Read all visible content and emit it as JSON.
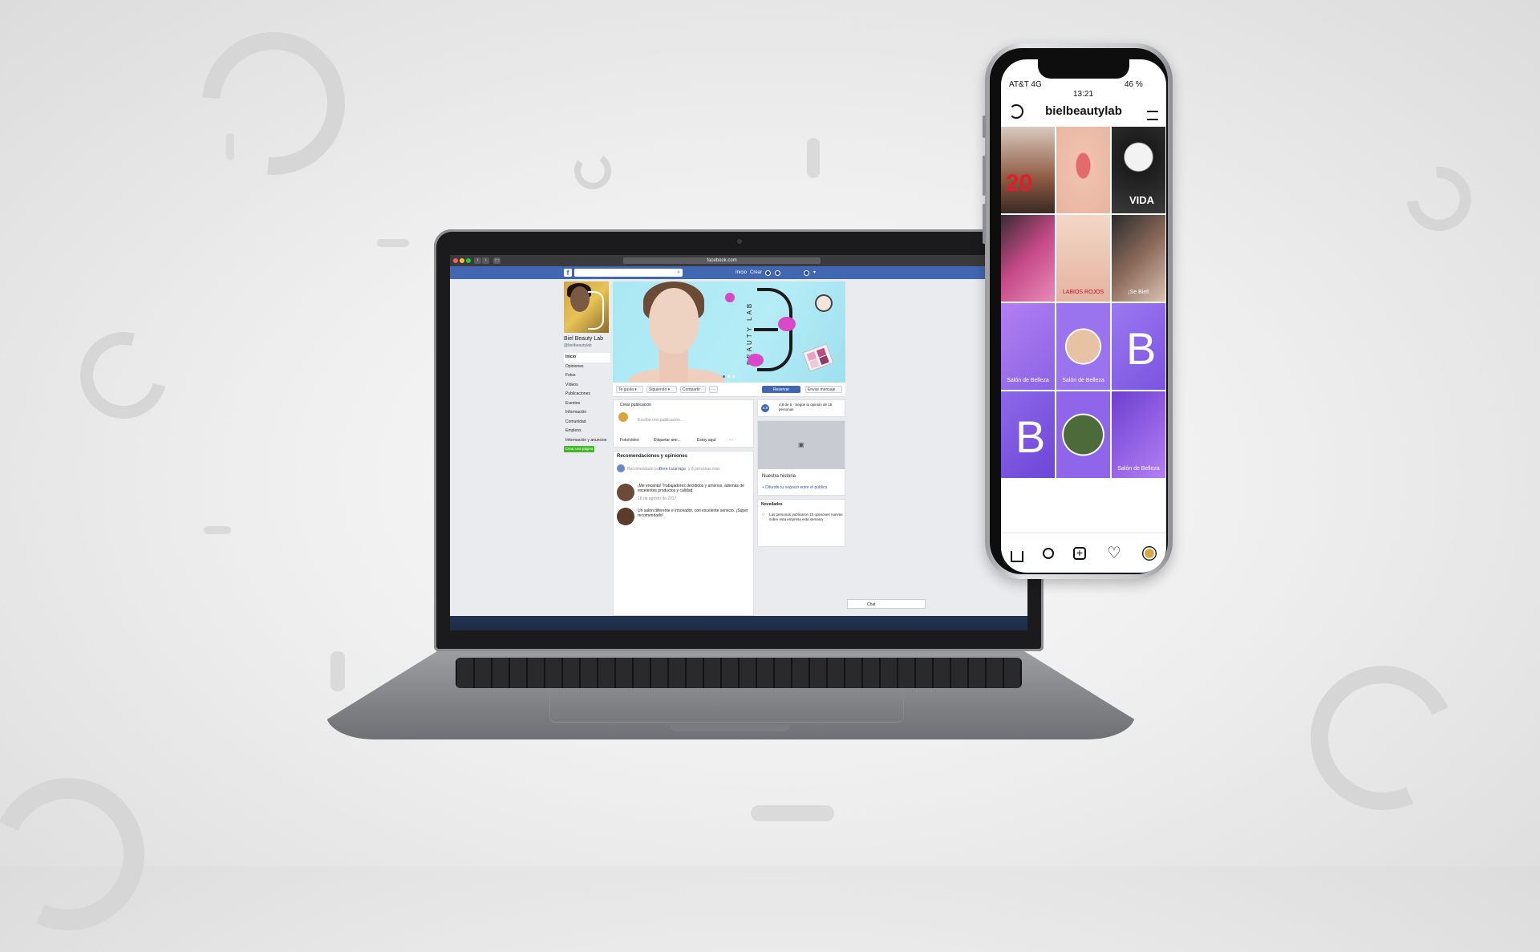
{
  "laptop": {
    "browser": {
      "url": "facebook.com"
    },
    "fb": {
      "search_icon": "search-icon",
      "nav": [
        "Inicio",
        "Crear"
      ],
      "page": {
        "name": "Biel Beauty Lab",
        "handle": "@bielbeautylab",
        "sidebar": [
          "Inicio",
          "Opiniones",
          "Fotos",
          "Vídeos",
          "Publicaciones",
          "Eventos",
          "Información",
          "Comunidad",
          "Empleos",
          "Información y anuncios"
        ],
        "promote_button": "Crear una página"
      },
      "actions": {
        "like": "Te gusta",
        "following": "Siguiendo",
        "share": "Compartir",
        "more": "···",
        "book": "Reservar",
        "message": "Enviar mensaje"
      },
      "cover": {
        "brand": "BEAUTY LAB"
      },
      "composer": {
        "header": "Crear publicación",
        "placeholder": "Escribe una publicación...",
        "photo": "Foto/vídeo",
        "tag": "Etiquetar ami...",
        "checkin": "Estoy aquí",
        "more": "···"
      },
      "reviews": {
        "title": "Recomendaciones y opiniones",
        "recommended_prefix": "Recomendado por",
        "recommended_names": "Bere Lizarraga",
        "recommended_suffix": "y 8 personas más",
        "items": [
          {
            "text": "¡Me encanta! Trabajadores decididos y amenos, además de excelentes productos y calidad.",
            "date": "18 de agosto de 2017"
          },
          {
            "text": "Un salón diferente e innovador, con excelente servicio. ¡Súper recomendado!",
            "date": ""
          }
        ]
      },
      "rating": {
        "score": "4.8",
        "text": "4,8 de 5 · Según la opinión de 15 personas"
      },
      "story": {
        "title": "Nuestra historia",
        "link": "+ Difunde tu negocio entre el público"
      },
      "news": {
        "title": "Novedades",
        "text": "Las personas publicaron 10 opiniones nuevas sobre esta empresa esta semana"
      },
      "chat": "Chat"
    }
  },
  "phone": {
    "status": {
      "carrier": "AT&T 4G",
      "time": "13:21",
      "battery": "46 %"
    },
    "instagram": {
      "username": "bielbeautylab",
      "tiles": [
        {
          "caption": "",
          "big": "20"
        },
        {
          "caption": "",
          "big": ""
        },
        {
          "caption": "",
          "big": "VIDA"
        },
        {
          "caption": "",
          "big": ""
        },
        {
          "caption": "LABIOS ROJOS",
          "big": ""
        },
        {
          "caption": "¡Se Biel!",
          "big": ""
        },
        {
          "caption": "Salón de Belleza",
          "big": ""
        },
        {
          "caption": "Salón de Belleza",
          "big": ""
        },
        {
          "caption": "",
          "big": "B"
        },
        {
          "caption": "",
          "big": "B"
        },
        {
          "caption": "",
          "big": ""
        },
        {
          "caption": "Salón de Belleza",
          "big": ""
        }
      ],
      "nav_icons": [
        "home-icon",
        "search-icon",
        "add-icon",
        "heart-icon",
        "profile-icon"
      ]
    }
  },
  "colors": {
    "fb_blue": "#4267b2",
    "ig_purple": "#8b63e6",
    "cover_cyan": "#b1ebf5",
    "promo_green": "#42b72a"
  }
}
